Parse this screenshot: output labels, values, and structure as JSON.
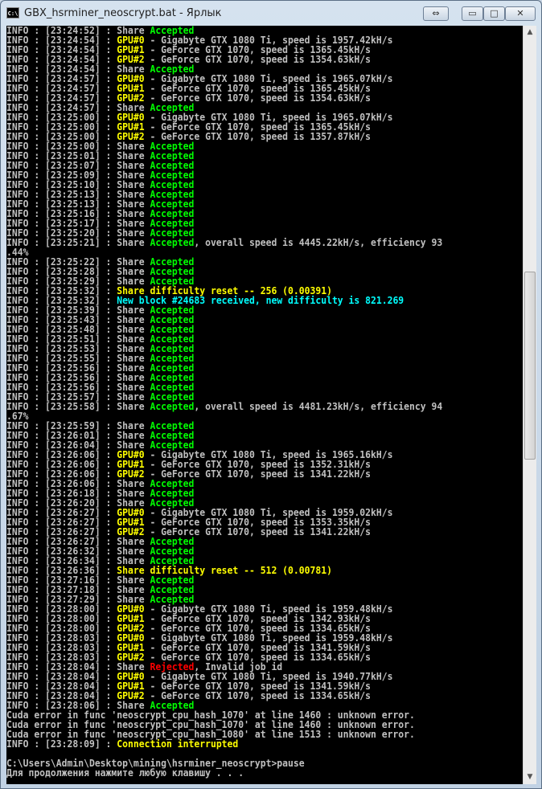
{
  "window": {
    "title": "GBX_hsrminer_neoscrypt.bat - Ярлык",
    "app_icon": "cmd-icon",
    "icon_text": "C:\\",
    "controls": {
      "restore": "⇔",
      "minimize": "▭",
      "maximize": "□",
      "close": "✕"
    }
  },
  "colors": {
    "background": "#000000",
    "text": "#c0c0c0",
    "accepted": "#00ff00",
    "gpu": "#ffff00",
    "new_block": "#00ffff",
    "rejected": "#ff0000"
  },
  "scrollbar": {
    "up": "▲",
    "down": "▼"
  },
  "console": {
    "lines": [
      [
        [
          "INFO : [23:24:52] : Share ",
          "white"
        ],
        [
          "Accepted",
          "green"
        ]
      ],
      [
        [
          "INFO : [23:24:54] : ",
          "white"
        ],
        [
          "GPU#0",
          "yellow"
        ],
        [
          " - Gigabyte GTX 1080 Ti, speed is 1957.42kH/s",
          "white"
        ]
      ],
      [
        [
          "INFO : [23:24:54] : ",
          "white"
        ],
        [
          "GPU#1",
          "yellow"
        ],
        [
          " - GeForce GTX 1070, speed is 1365.45kH/s",
          "white"
        ]
      ],
      [
        [
          "INFO : [23:24:54] : ",
          "white"
        ],
        [
          "GPU#2",
          "yellow"
        ],
        [
          " - GeForce GTX 1070, speed is 1354.63kH/s",
          "white"
        ]
      ],
      [
        [
          "INFO : [23:24:54] : Share ",
          "white"
        ],
        [
          "Accepted",
          "green"
        ]
      ],
      [
        [
          "INFO : [23:24:57] : ",
          "white"
        ],
        [
          "GPU#0",
          "yellow"
        ],
        [
          " - Gigabyte GTX 1080 Ti, speed is 1965.07kH/s",
          "white"
        ]
      ],
      [
        [
          "INFO : [23:24:57] : ",
          "white"
        ],
        [
          "GPU#1",
          "yellow"
        ],
        [
          " - GeForce GTX 1070, speed is 1365.45kH/s",
          "white"
        ]
      ],
      [
        [
          "INFO : [23:24:57] : ",
          "white"
        ],
        [
          "GPU#2",
          "yellow"
        ],
        [
          " - GeForce GTX 1070, speed is 1354.63kH/s",
          "white"
        ]
      ],
      [
        [
          "INFO : [23:24:57] : Share ",
          "white"
        ],
        [
          "Accepted",
          "green"
        ]
      ],
      [
        [
          "INFO : [23:25:00] : ",
          "white"
        ],
        [
          "GPU#0",
          "yellow"
        ],
        [
          " - Gigabyte GTX 1080 Ti, speed is 1965.07kH/s",
          "white"
        ]
      ],
      [
        [
          "INFO : [23:25:00] : ",
          "white"
        ],
        [
          "GPU#1",
          "yellow"
        ],
        [
          " - GeForce GTX 1070, speed is 1365.45kH/s",
          "white"
        ]
      ],
      [
        [
          "INFO : [23:25:00] : ",
          "white"
        ],
        [
          "GPU#2",
          "yellow"
        ],
        [
          " - GeForce GTX 1070, speed is 1357.87kH/s",
          "white"
        ]
      ],
      [
        [
          "INFO : [23:25:00] : Share ",
          "white"
        ],
        [
          "Accepted",
          "green"
        ]
      ],
      [
        [
          "INFO : [23:25:01] : Share ",
          "white"
        ],
        [
          "Accepted",
          "green"
        ]
      ],
      [
        [
          "INFO : [23:25:07] : Share ",
          "white"
        ],
        [
          "Accepted",
          "green"
        ]
      ],
      [
        [
          "INFO : [23:25:09] : Share ",
          "white"
        ],
        [
          "Accepted",
          "green"
        ]
      ],
      [
        [
          "INFO : [23:25:10] : Share ",
          "white"
        ],
        [
          "Accepted",
          "green"
        ]
      ],
      [
        [
          "INFO : [23:25:13] : Share ",
          "white"
        ],
        [
          "Accepted",
          "green"
        ]
      ],
      [
        [
          "INFO : [23:25:13] : Share ",
          "white"
        ],
        [
          "Accepted",
          "green"
        ]
      ],
      [
        [
          "INFO : [23:25:16] : Share ",
          "white"
        ],
        [
          "Accepted",
          "green"
        ]
      ],
      [
        [
          "INFO : [23:25:17] : Share ",
          "white"
        ],
        [
          "Accepted",
          "green"
        ]
      ],
      [
        [
          "INFO : [23:25:20] : Share ",
          "white"
        ],
        [
          "Accepted",
          "green"
        ]
      ],
      [
        [
          "INFO : [23:25:21] : Share ",
          "white"
        ],
        [
          "Accepted",
          "green"
        ],
        [
          ", overall speed is 4445.22kH/s, efficiency 93",
          "white"
        ]
      ],
      [
        [
          ".44%",
          "white"
        ]
      ],
      [
        [
          "INFO : [23:25:22] : Share ",
          "white"
        ],
        [
          "Accepted",
          "green"
        ]
      ],
      [
        [
          "INFO : [23:25:28] : Share ",
          "white"
        ],
        [
          "Accepted",
          "green"
        ]
      ],
      [
        [
          "INFO : [23:25:29] : Share ",
          "white"
        ],
        [
          "Accepted",
          "green"
        ]
      ],
      [
        [
          "INFO : [23:25:32] : ",
          "white"
        ],
        [
          "Share difficulty reset -- 256 (0.00391)",
          "yellow"
        ]
      ],
      [
        [
          "INFO : [23:25:32] : ",
          "white"
        ],
        [
          "New block #24683 received, new difficulty is 821.269",
          "cyan"
        ]
      ],
      [
        [
          "INFO : [23:25:39] : Share ",
          "white"
        ],
        [
          "Accepted",
          "green"
        ]
      ],
      [
        [
          "INFO : [23:25:43] : Share ",
          "white"
        ],
        [
          "Accepted",
          "green"
        ]
      ],
      [
        [
          "INFO : [23:25:48] : Share ",
          "white"
        ],
        [
          "Accepted",
          "green"
        ]
      ],
      [
        [
          "INFO : [23:25:51] : Share ",
          "white"
        ],
        [
          "Accepted",
          "green"
        ]
      ],
      [
        [
          "INFO : [23:25:53] : Share ",
          "white"
        ],
        [
          "Accepted",
          "green"
        ]
      ],
      [
        [
          "INFO : [23:25:55] : Share ",
          "white"
        ],
        [
          "Accepted",
          "green"
        ]
      ],
      [
        [
          "INFO : [23:25:56] : Share ",
          "white"
        ],
        [
          "Accepted",
          "green"
        ]
      ],
      [
        [
          "INFO : [23:25:56] : Share ",
          "white"
        ],
        [
          "Accepted",
          "green"
        ]
      ],
      [
        [
          "INFO : [23:25:56] : Share ",
          "white"
        ],
        [
          "Accepted",
          "green"
        ]
      ],
      [
        [
          "INFO : [23:25:57] : Share ",
          "white"
        ],
        [
          "Accepted",
          "green"
        ]
      ],
      [
        [
          "INFO : [23:25:58] : Share ",
          "white"
        ],
        [
          "Accepted",
          "green"
        ],
        [
          ", overall speed is 4481.23kH/s, efficiency 94",
          "white"
        ]
      ],
      [
        [
          ".67%",
          "white"
        ]
      ],
      [
        [
          "INFO : [23:25:59] : Share ",
          "white"
        ],
        [
          "Accepted",
          "green"
        ]
      ],
      [
        [
          "INFO : [23:26:01] : Share ",
          "white"
        ],
        [
          "Accepted",
          "green"
        ]
      ],
      [
        [
          "INFO : [23:26:04] : Share ",
          "white"
        ],
        [
          "Accepted",
          "green"
        ]
      ],
      [
        [
          "INFO : [23:26:06] : ",
          "white"
        ],
        [
          "GPU#0",
          "yellow"
        ],
        [
          " - Gigabyte GTX 1080 Ti, speed is 1965.16kH/s",
          "white"
        ]
      ],
      [
        [
          "INFO : [23:26:06] : ",
          "white"
        ],
        [
          "GPU#1",
          "yellow"
        ],
        [
          " - GeForce GTX 1070, speed is 1352.31kH/s",
          "white"
        ]
      ],
      [
        [
          "INFO : [23:26:06] : ",
          "white"
        ],
        [
          "GPU#2",
          "yellow"
        ],
        [
          " - GeForce GTX 1070, speed is 1341.22kH/s",
          "white"
        ]
      ],
      [
        [
          "INFO : [23:26:06] : Share ",
          "white"
        ],
        [
          "Accepted",
          "green"
        ]
      ],
      [
        [
          "INFO : [23:26:18] : Share ",
          "white"
        ],
        [
          "Accepted",
          "green"
        ]
      ],
      [
        [
          "INFO : [23:26:20] : Share ",
          "white"
        ],
        [
          "Accepted",
          "green"
        ]
      ],
      [
        [
          "INFO : [23:26:27] : ",
          "white"
        ],
        [
          "GPU#0",
          "yellow"
        ],
        [
          " - Gigabyte GTX 1080 Ti, speed is 1959.02kH/s",
          "white"
        ]
      ],
      [
        [
          "INFO : [23:26:27] : ",
          "white"
        ],
        [
          "GPU#1",
          "yellow"
        ],
        [
          " - GeForce GTX 1070, speed is 1353.35kH/s",
          "white"
        ]
      ],
      [
        [
          "INFO : [23:26:27] : ",
          "white"
        ],
        [
          "GPU#2",
          "yellow"
        ],
        [
          " - GeForce GTX 1070, speed is 1341.22kH/s",
          "white"
        ]
      ],
      [
        [
          "INFO : [23:26:27] : Share ",
          "white"
        ],
        [
          "Accepted",
          "green"
        ]
      ],
      [
        [
          "INFO : [23:26:32] : Share ",
          "white"
        ],
        [
          "Accepted",
          "green"
        ]
      ],
      [
        [
          "INFO : [23:26:34] : Share ",
          "white"
        ],
        [
          "Accepted",
          "green"
        ]
      ],
      [
        [
          "INFO : [23:26:36] : ",
          "white"
        ],
        [
          "Share difficulty reset -- 512 (0.00781)",
          "yellow"
        ]
      ],
      [
        [
          "INFO : [23:27:16] : Share ",
          "white"
        ],
        [
          "Accepted",
          "green"
        ]
      ],
      [
        [
          "INFO : [23:27:18] : Share ",
          "white"
        ],
        [
          "Accepted",
          "green"
        ]
      ],
      [
        [
          "INFO : [23:27:29] : Share ",
          "white"
        ],
        [
          "Accepted",
          "green"
        ]
      ],
      [
        [
          "INFO : [23:28:00] : ",
          "white"
        ],
        [
          "GPU#0",
          "yellow"
        ],
        [
          " - Gigabyte GTX 1080 Ti, speed is 1959.48kH/s",
          "white"
        ]
      ],
      [
        [
          "INFO : [23:28:00] : ",
          "white"
        ],
        [
          "GPU#1",
          "yellow"
        ],
        [
          " - GeForce GTX 1070, speed is 1342.93kH/s",
          "white"
        ]
      ],
      [
        [
          "INFO : [23:28:00] : ",
          "white"
        ],
        [
          "GPU#2",
          "yellow"
        ],
        [
          " - GeForce GTX 1070, speed is 1334.65kH/s",
          "white"
        ]
      ],
      [
        [
          "INFO : [23:28:03] : ",
          "white"
        ],
        [
          "GPU#0",
          "yellow"
        ],
        [
          " - Gigabyte GTX 1080 Ti, speed is 1959.48kH/s",
          "white"
        ]
      ],
      [
        [
          "INFO : [23:28:03] : ",
          "white"
        ],
        [
          "GPU#1",
          "yellow"
        ],
        [
          " - GeForce GTX 1070, speed is 1341.59kH/s",
          "white"
        ]
      ],
      [
        [
          "INFO : [23:28:03] : ",
          "white"
        ],
        [
          "GPU#2",
          "yellow"
        ],
        [
          " - GeForce GTX 1070, speed is 1334.65kH/s",
          "white"
        ]
      ],
      [
        [
          "INFO : [23:28:04] : Share ",
          "white"
        ],
        [
          "Rejected",
          "red"
        ],
        [
          ", Invalid job id",
          "white"
        ]
      ],
      [
        [
          "INFO : [23:28:04] : ",
          "white"
        ],
        [
          "GPU#0",
          "yellow"
        ],
        [
          " - Gigabyte GTX 1080 Ti, speed is 1940.77kH/s",
          "white"
        ]
      ],
      [
        [
          "INFO : [23:28:04] : ",
          "white"
        ],
        [
          "GPU#1",
          "yellow"
        ],
        [
          " - GeForce GTX 1070, speed is 1341.59kH/s",
          "white"
        ]
      ],
      [
        [
          "INFO : [23:28:04] : ",
          "white"
        ],
        [
          "GPU#2",
          "yellow"
        ],
        [
          " - GeForce GTX 1070, speed is 1334.65kH/s",
          "white"
        ]
      ],
      [
        [
          "INFO : [23:28:06] : Share ",
          "white"
        ],
        [
          "Accepted",
          "green"
        ]
      ],
      [
        [
          "Cuda error in func 'neoscrypt_cpu_hash_1070' at line 1460 : unknown error.",
          "white"
        ]
      ],
      [
        [
          "Cuda error in func 'neoscrypt_cpu_hash_1070' at line 1460 : unknown error.",
          "white"
        ]
      ],
      [
        [
          "Cuda error in func 'neoscrypt_cpu_hash_1080' at line 1513 : unknown error.",
          "white"
        ]
      ],
      [
        [
          "INFO : [23:28:09] : ",
          "white"
        ],
        [
          "Connection interrupted",
          "yellow"
        ]
      ],
      [
        [
          "",
          "white"
        ]
      ],
      [
        [
          "C:\\Users\\Admin\\Desktop\\mining\\hsrminer_neoscrypt>pause",
          "white"
        ]
      ],
      [
        [
          "Для продолжения нажмите любую клавишу . . .",
          "white"
        ]
      ]
    ]
  }
}
